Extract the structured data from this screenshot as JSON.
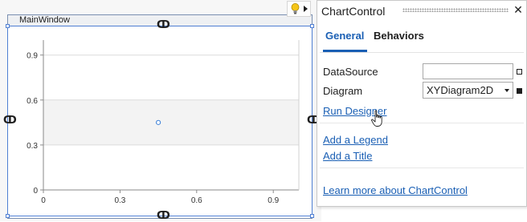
{
  "window": {
    "title": "MainWindow"
  },
  "chart": {
    "x_ticks": [
      "0",
      "0.3",
      "0.6",
      "0.9"
    ],
    "y_ticks": [
      "0",
      "0.3",
      "0.6",
      "0.9"
    ]
  },
  "chart_data": {
    "type": "scatter",
    "title": "",
    "xlabel": "",
    "ylabel": "",
    "xlim": [
      0,
      1
    ],
    "ylim": [
      0,
      1
    ],
    "x_ticks": [
      0,
      0.3,
      0.6,
      0.9
    ],
    "y_ticks": [
      0,
      0.3,
      0.6,
      0.9
    ],
    "grid": "horizontal bands",
    "series": [
      {
        "points": [
          {
            "x": 0.45,
            "y": 0.45
          }
        ]
      }
    ]
  },
  "panel": {
    "title": "ChartControl",
    "tabs": [
      {
        "label": "General",
        "active": true
      },
      {
        "label": "Behaviors",
        "active": false
      }
    ],
    "properties": {
      "datasource_label": "DataSource",
      "datasource_value": "",
      "diagram_label": "Diagram",
      "diagram_value": "XYDiagram2D"
    },
    "links": {
      "run_designer": "Run Designer",
      "add_legend": "Add a Legend",
      "add_title": "Add a Title",
      "learn_more": "Learn more about ChartControl"
    }
  },
  "colors": {
    "accent": "#1a5fb4",
    "selection": "#4f7fd3",
    "marker": "#3b7fd6"
  },
  "icons": {
    "bulb": "lightbulb-icon",
    "close": "close-icon",
    "anchor": "anchor-link-icon",
    "cursor": "hand-pointer-icon"
  }
}
